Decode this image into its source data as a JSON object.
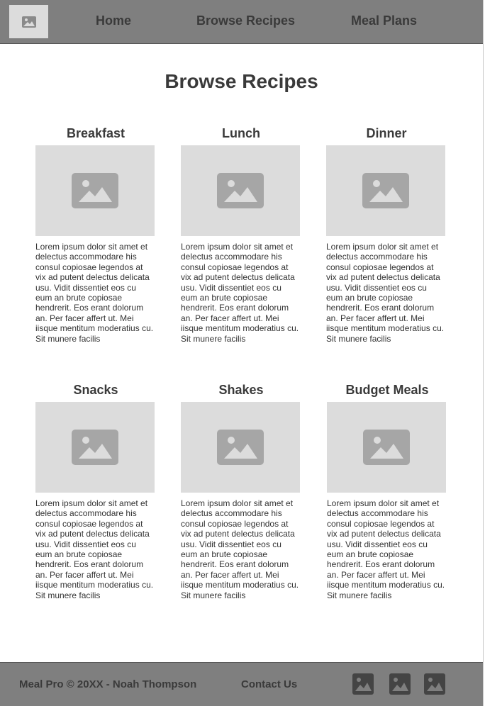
{
  "header": {
    "logo_icon": "image-placeholder-icon",
    "nav": {
      "home": "Home",
      "browse": "Browse Recipes",
      "meal_plans": "Meal Plans"
    }
  },
  "main": {
    "title": "Browse Recipes",
    "categories": [
      {
        "title": "Breakfast",
        "text": "Lorem ipsum dolor sit amet et delectus accommodare his consul copiosae legendos at vix ad putent delectus delicata usu. Vidit dissentiet eos cu eum an brute copiosae hendrerit. Eos erant dolorum an. Per facer affert ut. Mei iisque mentitum moderatius cu. Sit munere facilis"
      },
      {
        "title": "Lunch",
        "text": "Lorem ipsum dolor sit amet et delectus accommodare his consul copiosae legendos at vix ad putent delectus delicata usu. Vidit dissentiet eos cu eum an brute copiosae hendrerit. Eos erant dolorum an. Per facer affert ut. Mei iisque mentitum moderatius cu. Sit munere facilis"
      },
      {
        "title": "Dinner",
        "text": "Lorem ipsum dolor sit amet et delectus accommodare his consul copiosae legendos at vix ad putent delectus delicata usu. Vidit dissentiet eos cu eum an brute copiosae hendrerit. Eos erant dolorum an. Per facer affert ut. Mei iisque mentitum moderatius cu. Sit munere facilis"
      },
      {
        "title": "Snacks",
        "text": "Lorem ipsum dolor sit amet et delectus accommodare his consul copiosae legendos at vix ad putent delectus delicata usu. Vidit dissentiet eos cu eum an brute copiosae hendrerit. Eos erant dolorum an. Per facer affert ut. Mei iisque mentitum moderatius cu. Sit munere facilis"
      },
      {
        "title": "Shakes",
        "text": "Lorem ipsum dolor sit amet et delectus accommodare his consul copiosae legendos at vix ad putent delectus delicata usu. Vidit dissentiet eos cu eum an brute copiosae hendrerit. Eos erant dolorum an. Per facer affert ut. Mei iisque mentitum moderatius cu. Sit munere facilis"
      },
      {
        "title": "Budget Meals",
        "text": "Lorem ipsum dolor sit amet et delectus accommodare his consul copiosae legendos at vix ad putent delectus delicata usu. Vidit dissentiet eos cu eum an brute copiosae hendrerit. Eos erant dolorum an. Per facer affert ut. Mei iisque mentitum moderatius cu. Sit munere facilis"
      }
    ]
  },
  "footer": {
    "copyright": "Meal Pro © 20XX - Noah Thompson",
    "contact": "Contact Us",
    "social_icons": [
      "image-placeholder-icon",
      "image-placeholder-icon",
      "image-placeholder-icon"
    ]
  },
  "colors": {
    "bar": "#7f7f7f",
    "placeholder": "#dcdcdc",
    "text": "#3a3a3a"
  }
}
